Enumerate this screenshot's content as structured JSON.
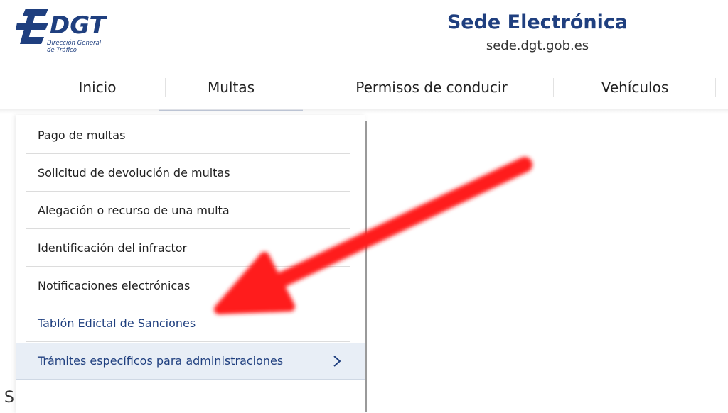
{
  "logo": {
    "word": "DGT",
    "subtitle": "Dirección General\nde Tráfico"
  },
  "header": {
    "title": "Sede Electrónica",
    "url": "sede.dgt.gob.es"
  },
  "nav": {
    "items": [
      {
        "label": "Inicio"
      },
      {
        "label": "Multas",
        "active": true
      },
      {
        "label": "Permisos de conducir"
      },
      {
        "label": "Vehículos"
      }
    ]
  },
  "menu": {
    "items": [
      {
        "label": "Pago de multas"
      },
      {
        "label": "Solicitud de devolución de multas"
      },
      {
        "label": "Alegación o recurso de una multa"
      },
      {
        "label": "Identificación del infractor"
      },
      {
        "label": "Notificaciones electrónicas"
      },
      {
        "label": "Tablón Edictal de Sanciones",
        "style": "link"
      },
      {
        "label": "Trámites específicos para administraciones",
        "style": "highlighted",
        "has_submenu": true
      }
    ]
  },
  "partial_text": "S",
  "colors": {
    "brand": "#1f3f7f",
    "arrow": "#ff1a1a",
    "highlight_bg": "#e8eef6"
  },
  "icons": {
    "logo_mark": "dgt-stripes-logo",
    "submenu": "chevron-right-icon",
    "annotation": "red-arrow-overlay"
  }
}
